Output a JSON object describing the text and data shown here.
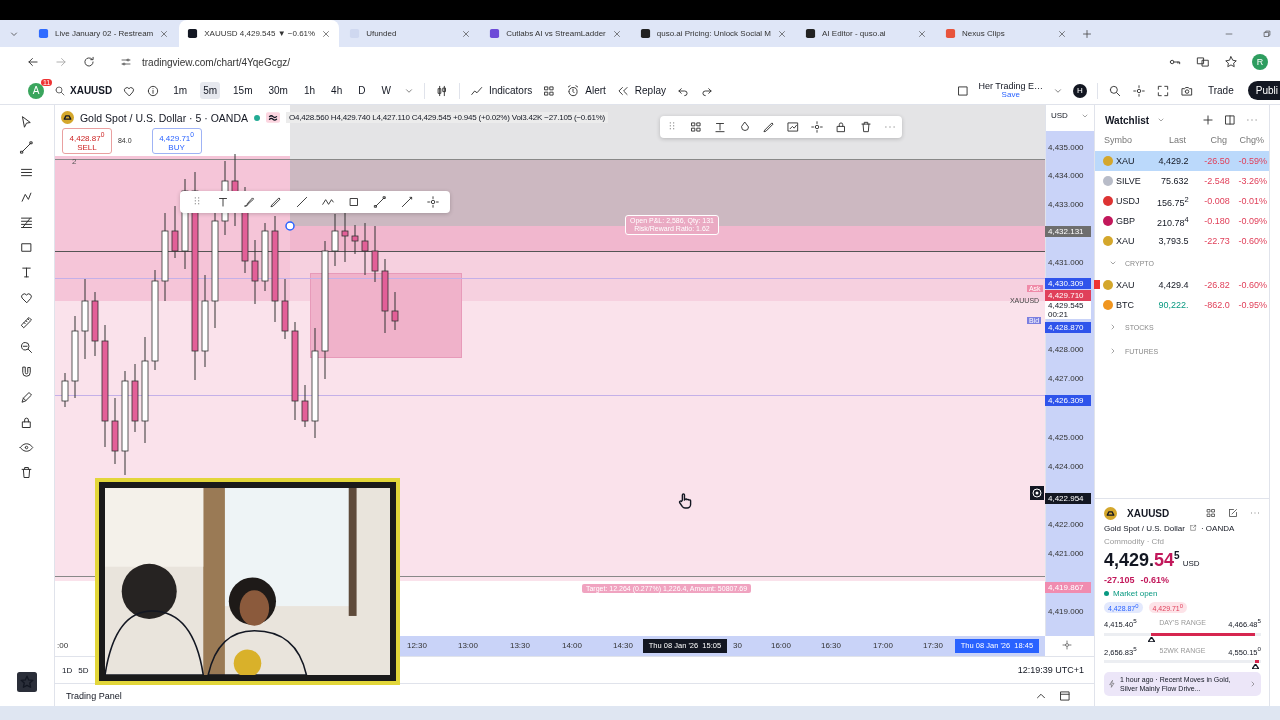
{
  "browser": {
    "tabs": [
      {
        "title": "Live January 02 - Restream",
        "selected": false
      },
      {
        "title": "XAUUSD 4,429.545 ▼ −0.61%",
        "selected": true
      },
      {
        "title": "Ufunded",
        "selected": false
      },
      {
        "title": "Cutlabs AI vs StreamLadder",
        "selected": false
      },
      {
        "title": "quso.ai Pricing: Unlock Social M",
        "selected": false
      },
      {
        "title": "AI Editor - quso.ai",
        "selected": false
      },
      {
        "title": "Nexus Clips",
        "selected": false
      }
    ],
    "url": "tradingview.com/chart/4YqeGcgz/",
    "profile": "R"
  },
  "toolbar": {
    "avatar": "A",
    "badge": "11",
    "symbol": "XAUUSD",
    "intervals": [
      {
        "label": "1m",
        "selected": false
      },
      {
        "label": "5m",
        "selected": true
      },
      {
        "label": "15m",
        "selected": false
      },
      {
        "label": "30m",
        "selected": false
      },
      {
        "label": "1h",
        "selected": false
      },
      {
        "label": "4h",
        "selected": false
      },
      {
        "label": "D",
        "selected": false
      },
      {
        "label": "W",
        "selected": false
      }
    ],
    "indicators": "Indicators",
    "alert": "Alert",
    "replay": "Replay",
    "layout_name": "Her Trading E…",
    "layout_save": "Save",
    "user": "H",
    "trade": "Trade",
    "publish": "Publi"
  },
  "chart": {
    "title": "Gold Spot / U.S. Dollar · 5 · OANDA",
    "ohlc": "O4,428.560 H4,429.740 L4,427.110 C4,429.545 +0.945 (+0.02%) Vol3.42K −27.105 (−0.61%)",
    "sell": {
      "price": "4,428.87$^{0}$",
      "label": "SELL"
    },
    "spread": "84.0",
    "buy": {
      "price": "4,429.71$^{0}$",
      "label": "BUY"
    },
    "legend_count": "2",
    "position_label": [
      "Open P&L: 2,586, Qty: 131",
      "Risk/Reward Ratio: 1.62"
    ],
    "target_label": "Target: 12.264 (0.277%) 1,226.4, Amount: 50807.69",
    "ask": "Ask",
    "bid": "Bid",
    "symbol_tag": "XAUUSD",
    "currency": "USD",
    "price_scale": [
      "4,435.000",
      "4,434.000",
      "4,433.000",
      "4,431.000",
      "4,428.000",
      "4,427.000",
      "4,425.000",
      "4,424.000",
      "4,422.000",
      "4,421.000",
      "4,419.000"
    ],
    "price_tags": [
      {
        "text": "4,432.131",
        "color": "#6e6e6e"
      },
      {
        "text": "4,430.309",
        "color": "#2f54eb"
      },
      {
        "text": "4,429.710",
        "color": "#e0405a"
      },
      {
        "text": "4,428.870",
        "color": "#2f54eb"
      },
      {
        "text": "4,426.309",
        "color": "#2f54eb"
      },
      {
        "text": "4,422.954",
        "color": "#131722"
      },
      {
        "text": "4,419.867",
        "color": "#f08cb0"
      }
    ],
    "current_price": {
      "text": "4,429.545",
      "countdown": "00:21"
    },
    "time_scale": [
      ":00",
      "12:30",
      "13:00",
      "13:30",
      "14:00",
      "14:30",
      "30",
      "16:00",
      "16:30",
      "17:00",
      "17:30"
    ],
    "time_tags": [
      {
        "text": "Thu 08 Jan '26  15:05",
        "color": "#131722"
      },
      {
        "text": "Thu 08 Jan '26  18:45",
        "color": "#2962ff"
      }
    ],
    "ranges": [
      "1D",
      "5D"
    ],
    "clock": "12:19:39 UTC+1",
    "trading_panel": "Trading Panel"
  },
  "watchlist": {
    "title": "Watchlist",
    "columns": [
      "Symbo",
      "Last",
      "Chg",
      "Chg%"
    ],
    "rows": [
      {
        "symbol": "XAU",
        "last": "4,429.2",
        "chg": "-26.50",
        "chg_pct": "-0.59%",
        "selected": true,
        "flagged": false,
        "last_up": false
      },
      {
        "symbol": "SILVE",
        "last": "75.632",
        "chg": "-2.548",
        "chg_pct": "-3.26%",
        "selected": false,
        "flagged": false,
        "last_up": false
      },
      {
        "symbol": "USDJ",
        "last": "156.75$^{2}$",
        "chg": "-0.008",
        "chg_pct": "-0.01%",
        "selected": false,
        "flagged": false,
        "last_up": false
      },
      {
        "symbol": "GBP",
        "last": "210.78$^{4}$",
        "chg": "-0.180",
        "chg_pct": "-0.09%",
        "selected": false,
        "flagged": false,
        "last_up": false
      },
      {
        "symbol": "XAU",
        "last": "3,793.5",
        "chg": "-22.73",
        "chg_pct": "-0.60%",
        "selected": false,
        "flagged": false,
        "last_up": false
      }
    ],
    "sections": [
      {
        "label": "CRYPTO",
        "expanded": true,
        "rows": [
          {
            "symbol": "XAU",
            "last": "4,429.4",
            "chg": "-26.82",
            "chg_pct": "-0.60%",
            "selected": false,
            "flagged": true,
            "last_up": false
          },
          {
            "symbol": "BTC",
            "last": "90,222.",
            "chg": "-862.0",
            "chg_pct": "-0.95%",
            "selected": false,
            "flagged": false,
            "last_up": true
          }
        ]
      },
      {
        "label": "STOCKS",
        "expanded": false
      },
      {
        "label": "FUTURES",
        "expanded": false
      }
    ]
  },
  "details": {
    "symbol": "XAUUSD",
    "name": "Gold Spot / U.S. Dollar",
    "exchange": "· OANDA",
    "type": "Commodity · Cfd",
    "price_main": "4,429.",
    "price_tail": "54",
    "price_sup": "5",
    "currency": "USD",
    "change": "-27.105",
    "change_pct": "-0.61%",
    "status": "Market open",
    "bid": "4,428.87$^{0}$",
    "ask": "4,429.71$^{0}$",
    "days_range": {
      "low": "4,415.40$^{5}$",
      "label": "DAY'S RANGE",
      "high": "4,466.48$^{5}$",
      "level": 0.3
    },
    "week52_range": {
      "low": "2,656.83$^{5}$",
      "label": "52WK RANGE",
      "high": "4,550.15$^{0}$",
      "level": 0.96
    },
    "news": "1 hour ago · Recent Moves in Gold, Silver Mainly Flow Drive..."
  }
}
